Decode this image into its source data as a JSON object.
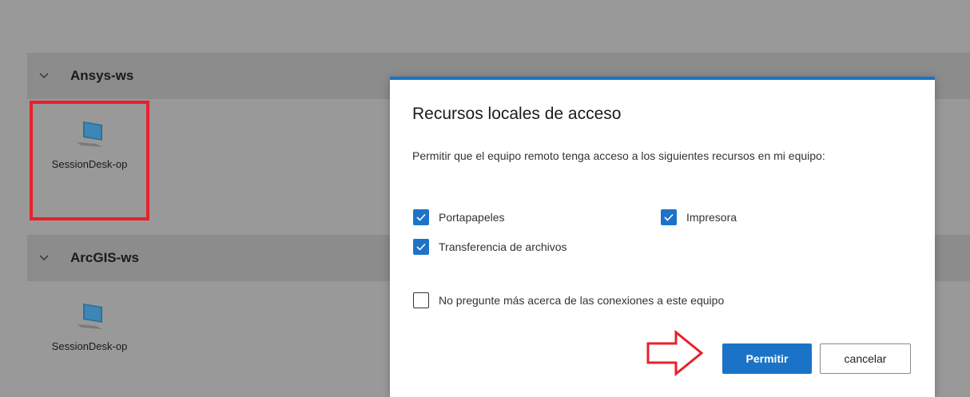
{
  "groups": [
    {
      "title": "Ansys-ws",
      "tile_label": "SessionDesk-op"
    },
    {
      "title": "ArcGIS-ws",
      "tile_label": "SessionDesk-op"
    }
  ],
  "dialog": {
    "title": "Recursos locales de acceso",
    "description": "Permitir que el equipo remoto tenga acceso a los siguientes recursos en mi equipo:",
    "options": {
      "clipboard": {
        "label": "Portapapeles",
        "checked": true
      },
      "printer": {
        "label": "Impresora",
        "checked": true
      },
      "file_transfer": {
        "label": "Transferencia de archivos",
        "checked": true
      },
      "dont_ask": {
        "label": "No pregunte más acerca de las conexiones a este equipo",
        "checked": false
      }
    },
    "buttons": {
      "allow": "Permitir",
      "cancel": "cancelar"
    }
  },
  "colors": {
    "accent": "#1a73c6",
    "highlight": "#e8202a",
    "overlay": "#999999"
  },
  "icons": [
    "chevron-down-icon",
    "computer-icon",
    "checkmark-icon",
    "arrow-right-icon"
  ]
}
